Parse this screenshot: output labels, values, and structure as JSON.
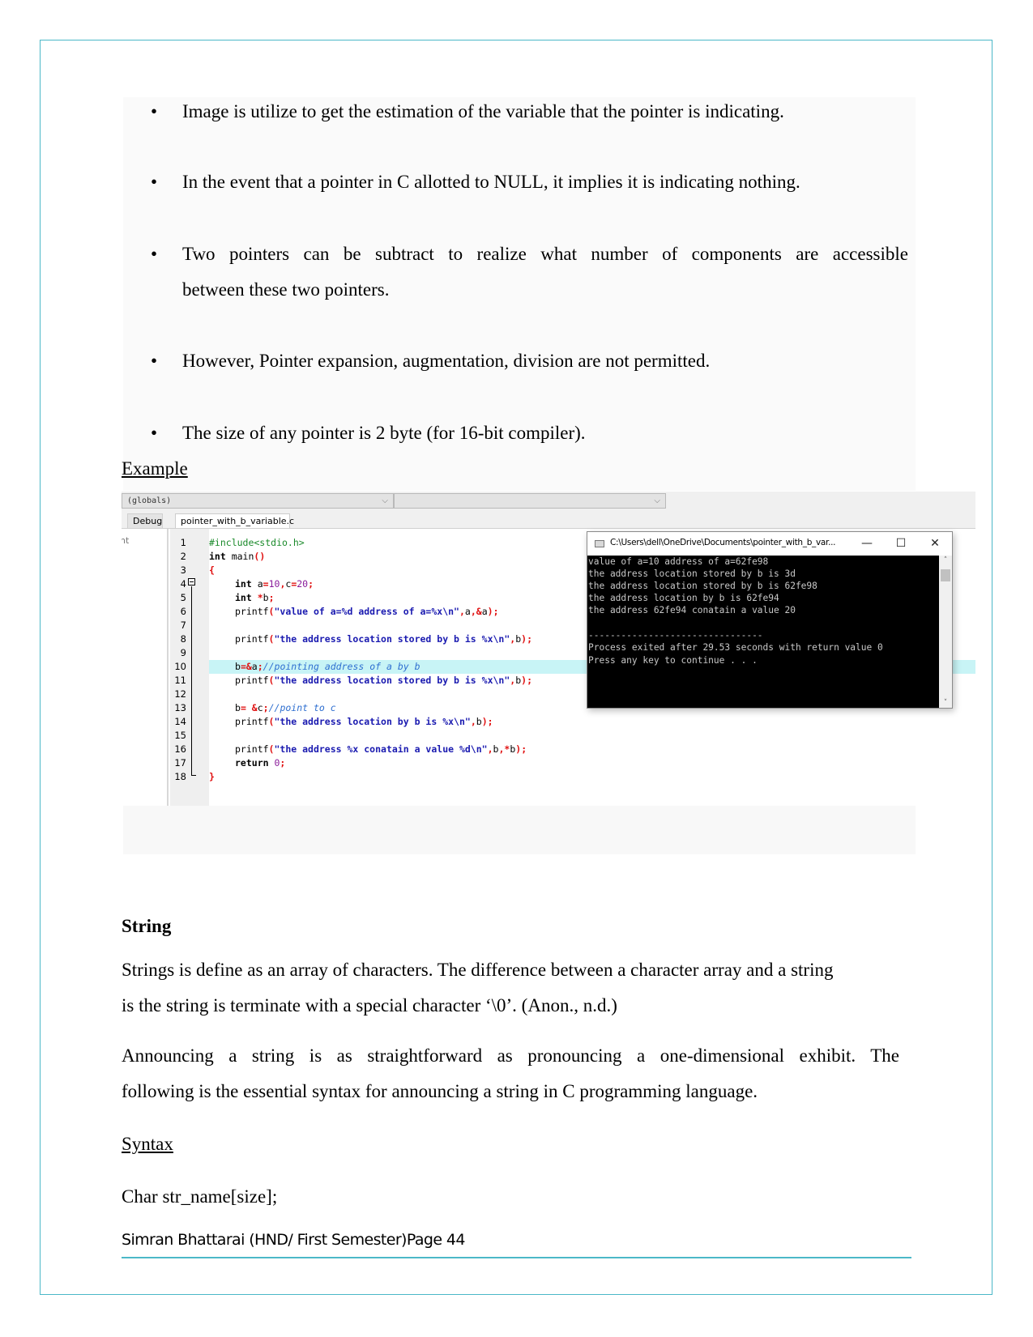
{
  "bullets": [
    {
      "text": "Image is utilize to get the estimation of the variable that the pointer is indicating."
    },
    {
      "text": "In the event that a pointer in C allotted to NULL, it implies it is indicating nothing."
    },
    {
      "text_line1": "Two pointers can be subtract to realize what number of components are accessible",
      "text_line2": "between these two pointers."
    },
    {
      "text": "However, Pointer expansion, augmentation, division are not permitted."
    },
    {
      "text": "The size of any pointer is 2 byte (for 16-bit compiler)."
    }
  ],
  "bullet_glyph": "•",
  "example_heading": "Example",
  "ide": {
    "scope_dropdown": "(globals)",
    "member_dropdown": "",
    "dropdown_icon": "chevron-down-icon",
    "left_panel_tab": "Debug",
    "left_panel_text": "nt",
    "file_tab": "pointer_with_b_variable.c",
    "highlighted_line": 10,
    "code_lines": [
      {
        "no": "1"
      },
      {
        "no": "2"
      },
      {
        "no": "3"
      },
      {
        "no": "4"
      },
      {
        "no": "5"
      },
      {
        "no": "6"
      },
      {
        "no": "7"
      },
      {
        "no": "8"
      },
      {
        "no": "9"
      },
      {
        "no": "10"
      },
      {
        "no": "11"
      },
      {
        "no": "12"
      },
      {
        "no": "13"
      },
      {
        "no": "14"
      },
      {
        "no": "15"
      },
      {
        "no": "16"
      },
      {
        "no": "17"
      },
      {
        "no": "18"
      }
    ],
    "code": {
      "l1": "#include<stdio.h>",
      "l2_kw": "int",
      "l2_fn": " main",
      "l2_p": "()",
      "l3": "{",
      "l4_kw": "int",
      "l4_a": " a",
      "l4_eq1": "=",
      "l4_n1": "10",
      "l4_c1": ",",
      "l4_c": "c",
      "l4_eq2": "=",
      "l4_n2": "20",
      "l4_sc": ";",
      "l5_kw": "int",
      "l5_star": " *",
      "l5_b": "b",
      "l5_sc": ";",
      "l6_fn": "printf",
      "l6_op": "(",
      "l6_str": "\"value of a=%d address of a=%x\\n\"",
      "l6_c1": ",",
      "l6_a": "a",
      "l6_c2": ",",
      "l6_amp": "&",
      "l6_a2": "a",
      "l6_end": ");",
      "l8_fn": "printf",
      "l8_op": "(",
      "l8_str": "\"the address location stored by b is %x\\n\"",
      "l8_c": ",",
      "l8_b": "b",
      "l8_end": ");",
      "l10_b": "b",
      "l10_eq": "=&",
      "l10_a": "a",
      "l10_sc": ";",
      "l10_cm": "//pointing address of a by b",
      "l11_fn": "printf",
      "l11_op": "(",
      "l11_str": "\"the address location stored by b is %x\\n\"",
      "l11_c": ",",
      "l11_b": "b",
      "l11_end": ");",
      "l13_b": "b",
      "l13_eq": "= &",
      "l13_c": "c",
      "l13_sc": ";",
      "l13_cm": "//point to c",
      "l14_fn": "printf",
      "l14_op": "(",
      "l14_str": "\"the address location by b is %x\\n\"",
      "l14_c": ",",
      "l14_b": "b",
      "l14_end": ");",
      "l16_fn": "printf",
      "l16_op": "(",
      "l16_str": "\"the address %x conatain a value %d\\n\"",
      "l16_c1": ",",
      "l16_b": "b",
      "l16_c2": ",*",
      "l16_b2": "b",
      "l16_end": ");",
      "l17_kw": "return",
      "l17_n": " 0",
      "l17_sc": ";",
      "l18": "}"
    }
  },
  "console": {
    "title": "C:\\Users\\dell\\OneDrive\\Documents\\pointer_with_b_var...",
    "minimize_glyph": "—",
    "maximize_glyph": "☐",
    "close_glyph": "✕",
    "scroll_up_glyph": "˄",
    "scroll_down_glyph": "˅",
    "lines": [
      "value of a=10 address of a=62fe98",
      "the address location stored by b is 3d",
      "the address location stored by b is 62fe98",
      "the address location by b is 62fe94",
      "the address 62fe94 conatain a value 20",
      "",
      "--------------------------------",
      "Process exited after 29.53 seconds with return value 0",
      "Press any key to continue . . ."
    ]
  },
  "string_section": {
    "heading": "String",
    "para1_line1": "Strings is define as an array of characters. The difference between a character array and a string",
    "para1_line2": "is the string is terminate with a special character ‘\\0’. (Anon., n.d.)",
    "para2_line1": "Announcing a string is as straightforward as pronouncing a one-dimensional exhibit. The",
    "para2_line2": "following is the essential syntax for announcing a string in C programming language.",
    "syntax_heading": "Syntax",
    "syntax_code": "Char str_name[size];"
  },
  "footer": {
    "text": "Simran Bhattarai (HND/ First Semester)Page 44"
  },
  "colors": {
    "accent_border": "#4bb8c8",
    "highlight_line": "#c8f4f6",
    "console_bg": "#000000",
    "string_literal": "#1a1ab0",
    "operator": "#e01010",
    "number": "#8a1a9a",
    "preprocessor": "#1a8a2a",
    "comment": "#2f6fd0"
  }
}
